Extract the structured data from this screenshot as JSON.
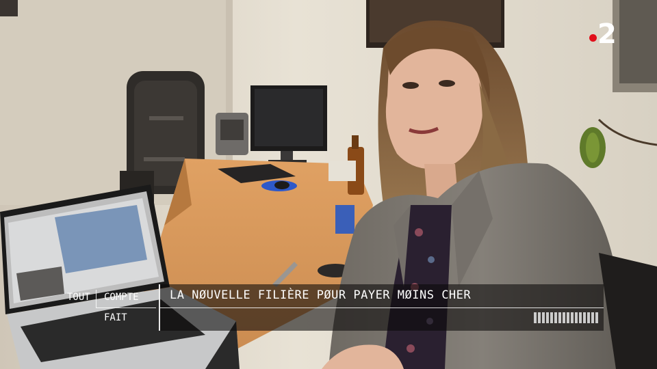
{
  "broadcast": {
    "channel_logo_number": "2",
    "logo_dot_color": "#e10f1a"
  },
  "lower_third": {
    "show_words": [
      "TOUT",
      "COMPTE",
      "FAIT"
    ],
    "headline": "LA NØUVELLE FILIÈRE PØUR PAYER MØINS CHER"
  }
}
